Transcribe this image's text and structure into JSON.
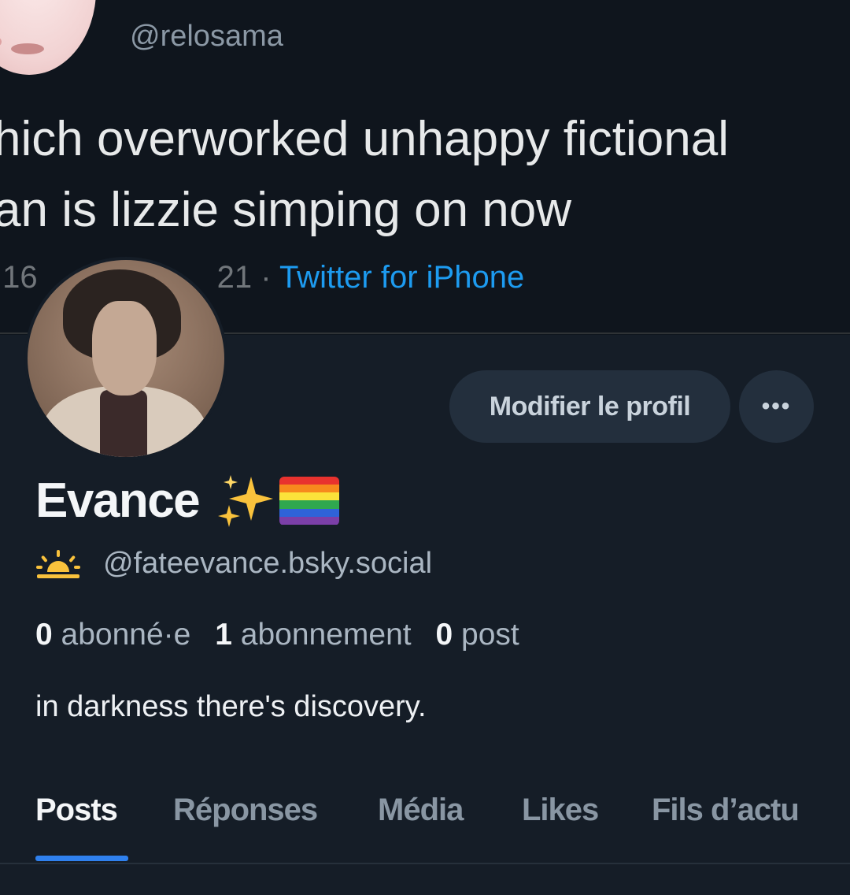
{
  "banner": {
    "handle": "@relosama",
    "tweet_lines": [
      "hich overworked unhappy fictional",
      "an is lizzie simping on now"
    ],
    "meta_time": ":16",
    "meta_date": "21",
    "meta_separator": "·",
    "meta_source": "Twitter for iPhone"
  },
  "profile": {
    "display_name": "Evance",
    "handle": "@fateevance.bsky.social",
    "edit_button_label": "Modifier le profil",
    "more_button_label": "•••",
    "bio": "in darkness there's discovery."
  },
  "stats": {
    "followers_count": "0",
    "followers_label": "abonné·e",
    "following_count": "1",
    "following_label": "abonnement",
    "posts_count": "0",
    "posts_label": "post"
  },
  "tabs": [
    {
      "label": "Posts",
      "active": true
    },
    {
      "label": "Réponses",
      "active": false
    },
    {
      "label": "Média",
      "active": false
    },
    {
      "label": "Likes",
      "active": false
    },
    {
      "label": "Fils d’actu",
      "active": false
    }
  ],
  "icons": {
    "name_emoji_1": "sparkles-icon",
    "name_emoji_2": "rainbow-flag-icon",
    "handle_prefix": "sunrise-icon"
  },
  "colors": {
    "background": "#151d27",
    "accent": "#2f80ed",
    "link": "#1d9bf0"
  }
}
